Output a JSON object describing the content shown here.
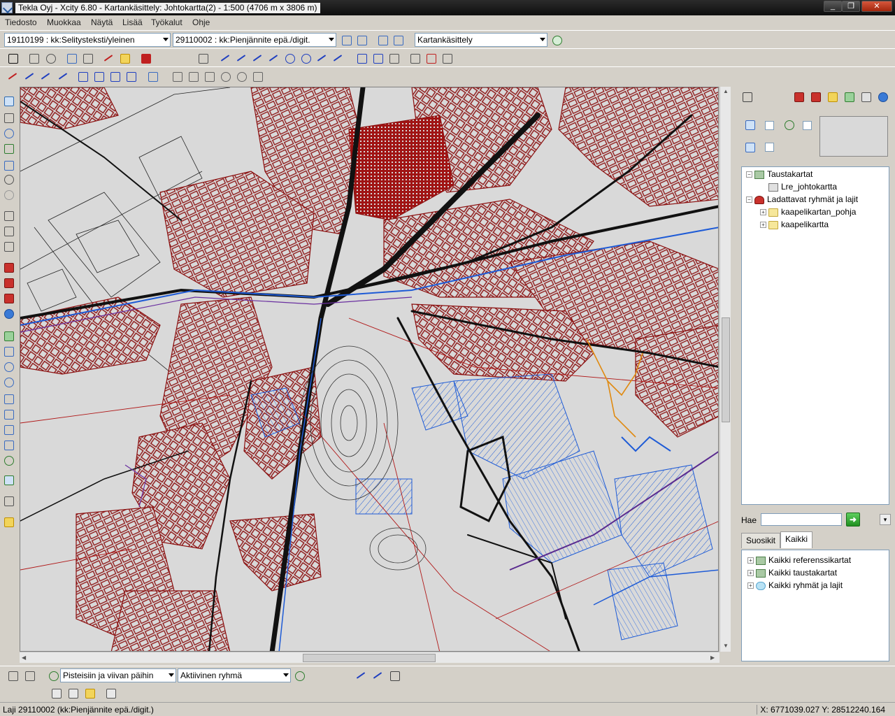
{
  "window": {
    "title": "Tekla Oyj - Xcity 6.80 - Kartankäsittely: Johtokartta(2) - 1:500 (4706 m x 3806 m)"
  },
  "menu": [
    "Tiedosto",
    "Muokkaa",
    "Näytä",
    "Lisää",
    "Työkalut",
    "Ohje"
  ],
  "toolbar": {
    "combo1": "19110199 : kk:Selitysteksti/yleinen",
    "combo2": "29110002 : kk:Pienjännite epä./digit.",
    "combo3": "Kartankäsittely"
  },
  "panel": {
    "tree_top": [
      {
        "label": "Taustakartat",
        "icon": "layer-icon",
        "expander": "−"
      },
      {
        "label": "Lre_johtokartta",
        "icon": "doc-icon",
        "expander": ""
      },
      {
        "label": "Ladattavat ryhmät ja lajit",
        "icon": "red-cube-icon",
        "expander": "−"
      },
      {
        "label": "kaapelikartan_pohja",
        "icon": "folder-icon",
        "expander": "+"
      },
      {
        "label": "kaapelikartta",
        "icon": "folder-icon",
        "expander": "+"
      }
    ],
    "search_label": "Hae",
    "search_value": "",
    "tabs": [
      "Suosikit",
      "Kaikki"
    ],
    "tree_bottom": [
      {
        "label": "Kaikki referenssikartat",
        "icon": "layer-icon",
        "expander": "+"
      },
      {
        "label": "Kaikki taustakartat",
        "icon": "layer-icon",
        "expander": "+"
      },
      {
        "label": "Kaikki ryhmät ja lajit",
        "icon": "cloud-icon",
        "expander": "+"
      }
    ]
  },
  "bottom_toolbar": {
    "snap_mode": "Pisteisiin ja viivan päihin",
    "active_group": "Aktiivinen ryhmä"
  },
  "status": {
    "left": "Laji 29110002 (kk:Pienjännite epä./digit.)",
    "coords": "X: 6771039.027  Y: 28512240.164"
  },
  "colors": {
    "map_background": "#d9d9d9",
    "building_red": "#8b1010",
    "road_black": "#111111",
    "pipe_blue": "#1e5bd6",
    "accent_orange": "#e08a10"
  }
}
